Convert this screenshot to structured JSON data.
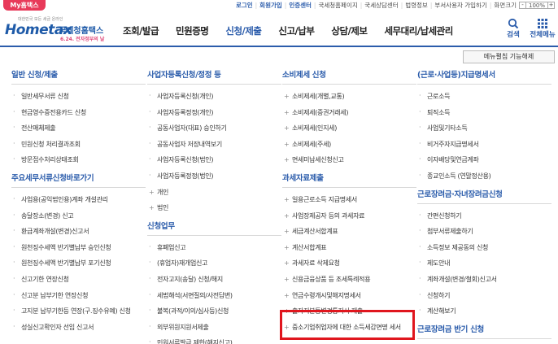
{
  "util": {
    "my_tax": "My홈택스",
    "links": [
      {
        "label": "로그인",
        "strong": true
      },
      {
        "label": "회원가입",
        "strong": true
      },
      {
        "label": "인증센터",
        "strong": true
      },
      {
        "label": "국세청홈페이지",
        "strong": false
      },
      {
        "label": "국세상담센터",
        "strong": false
      },
      {
        "label": "법령정보",
        "strong": false
      },
      {
        "label": "부서사용자 가입하기",
        "strong": false
      },
      {
        "label": "화면크기",
        "strong": false
      }
    ],
    "zoom_minus": "-",
    "zoom_value": "100%",
    "zoom_plus": "+"
  },
  "logo": {
    "tiny": "대한민국 모든 세금 온라인",
    "name": "Hometax",
    "korean": "국세청홈택스",
    "sub": "6.24. 전자정부의 날"
  },
  "menu": [
    {
      "label": "조회/발급",
      "active": false
    },
    {
      "label": "민원증명",
      "active": false
    },
    {
      "label": "신청/제출",
      "active": true
    },
    {
      "label": "신고/납부",
      "active": false
    },
    {
      "label": "상담/제보",
      "active": false
    },
    {
      "label": "세무대리/납세관리",
      "active": false
    }
  ],
  "search_label": "검색",
  "all_menu_label": "전체메뉴",
  "menu_pref_button": "메뉴펼침 기능해제",
  "colors": {
    "brand": "#2b5cab",
    "highlight": "#e0161e",
    "mytax": "#e83a5a"
  },
  "columns": [
    {
      "sections": [
        {
          "title": "일반 신청/제출",
          "items": [
            "일반세무서류 신청",
            "현금영수증전용카드 신청",
            "전산매체제출",
            "민원신청 처리결과조회",
            "방문접수처리상태조회"
          ]
        },
        {
          "title": "주요세무서류신청바로가기",
          "items": [
            "사업용(공익법인용)계좌 개설관리",
            "송달장소(변경) 신고",
            "환급계좌개설(변경)신고서",
            "원천징수세액 반기별납부 승인신청",
            "원천징수세액 반기별납부 포기신청",
            "신고기한 연장신청",
            "신고분 납부기한 연장신청",
            "고지분 납부기한등 연장(구.징수유예) 신청",
            "성실신고확인자 선임 신고서"
          ]
        }
      ]
    },
    {
      "sections": [
        {
          "title": "사업자등록신청/정정 등",
          "items": [
            "사업자등록신청(개인)",
            "사업자등록정정(개인)",
            "공동사업자(대표) 승인하기",
            "공동사업자 저장내역보기",
            "사업자등록신청(법인)",
            "사업자등록정정(법인)",
            "개인",
            "법인"
          ]
        },
        {
          "title": "신청업무",
          "items": [
            "휴폐업신고",
            "(휴업자)재개업신고",
            "전자고지(송달) 신청/해지",
            "세법해석(서면질의/사전답변)",
            "불복(과적/이의/심사등)신청",
            "외부위원지원서제출",
            "민원서류발급 제한(해지신고)"
          ]
        }
      ]
    },
    {
      "sections": [
        {
          "title": "소비제세 신청",
          "items": [
            "소비제세(개별,교통)",
            "소비제세(증권거래세)",
            "소비제세(인지세)",
            "소비제세(주세)",
            "면세미납세신청신고"
          ]
        },
        {
          "title": "과세자료제출",
          "items": [
            "일용근로소득 지급명세서",
            "사업장제공자 등의 과세자료",
            "세금계산서합계표",
            "계산서합계표",
            "과세자료 삭제요청",
            "신용금융상품 등 조세특례적용",
            "연금수령개시및해지명세서",
            "출자지분등변경통지서 제출",
            "중소기업취업자에 대한 소득세감면명 세서"
          ]
        }
      ]
    },
    {
      "sections": [
        {
          "title": "(근로·사업등)지급명세서",
          "items": [
            "근로소득",
            "퇴직소득",
            "사업및기타소득",
            "비거주자지급명세서",
            "이자배당및연금계좌",
            "종교인소득 (연말정산용)"
          ]
        },
        {
          "title": "근로장려금·자녀장려금신청",
          "items": [
            "간편신청하기",
            "첨부서류제출하기",
            "소득정보 제공동의 신청",
            "제도안내",
            "계좌개설(변경/철회)신고서",
            "신청하기",
            "계산해보기"
          ]
        },
        {
          "title": "근로장려금 반기 신청",
          "items": []
        }
      ]
    }
  ]
}
